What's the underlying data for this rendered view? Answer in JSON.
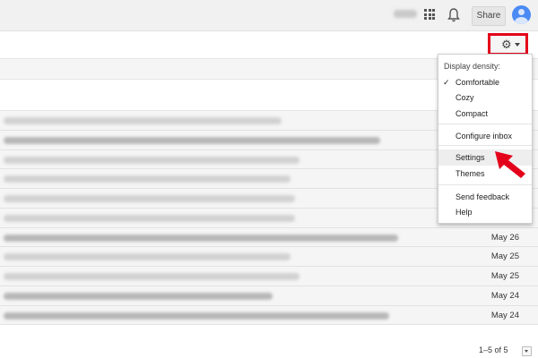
{
  "header": {
    "share_label": "Share"
  },
  "settings_menu": {
    "display_density_label": "Display density:",
    "density_options": [
      "Comfortable",
      "Cozy",
      "Compact"
    ],
    "selected_density": "Comfortable",
    "configure_inbox": "Configure inbox",
    "settings": "Settings",
    "themes": "Themes",
    "send_feedback": "Send feedback",
    "help": "Help"
  },
  "email_rows": [
    {
      "date": ""
    },
    {
      "date": ""
    },
    {
      "date": ""
    },
    {
      "date": ""
    },
    {
      "date": ""
    },
    {
      "date": ""
    },
    {
      "date": "May 26"
    },
    {
      "date": "May 25"
    },
    {
      "date": "May 25"
    },
    {
      "date": "May 24"
    },
    {
      "date": "May 24"
    }
  ],
  "pagination": {
    "range": "1–5 of 5"
  },
  "colors": {
    "highlight_red": "#e4001b",
    "avatar_blue": "#4a8af4"
  },
  "icons": [
    "apps-grid-icon",
    "bell-icon",
    "avatar-icon",
    "gear-icon",
    "chevron-down-icon",
    "checkmark-icon",
    "red-arrow-pointer"
  ]
}
